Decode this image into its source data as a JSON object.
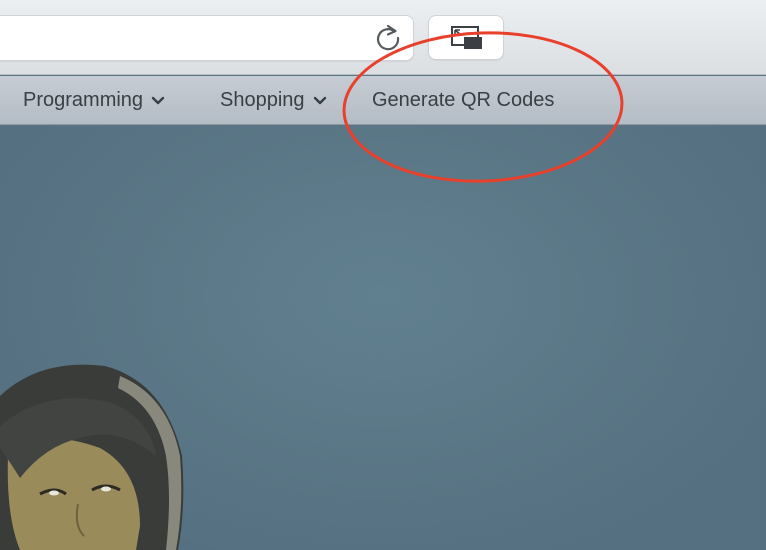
{
  "browser": {
    "toolbar": {
      "reload_icon": "reload-icon",
      "pip_icon": "picture-in-picture-icon"
    },
    "bookmarks": [
      {
        "label": "Programming",
        "has_dropdown": true
      },
      {
        "label": "Shopping",
        "has_dropdown": true
      },
      {
        "label": "Generate QR Codes",
        "has_dropdown": false
      }
    ]
  },
  "annotation": {
    "shape": "ellipse",
    "color": "#e8402b",
    "target": "Generate QR Codes"
  },
  "colors": {
    "page_background": "#5a7585",
    "bookmarks_bar": "#bfc6ce",
    "text": "#3a3f44"
  }
}
